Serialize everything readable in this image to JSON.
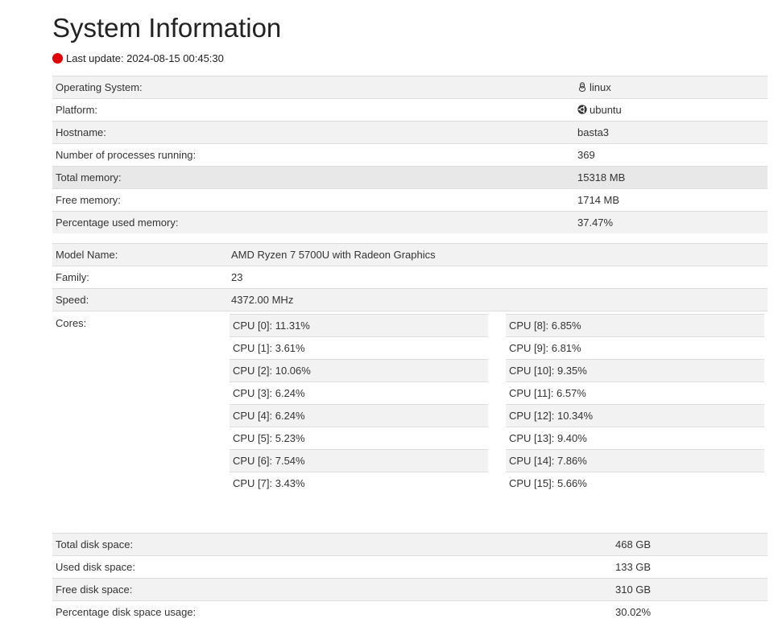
{
  "header": {
    "title": "System Information",
    "last_update_label": "Last update: 2024-08-15 00:45:30",
    "status_color": "#e00000"
  },
  "system": [
    {
      "label": "Operating System:",
      "value": "linux",
      "icon": "linux-tux-icon"
    },
    {
      "label": "Platform:",
      "value": "ubuntu",
      "icon": "ubuntu-icon"
    },
    {
      "label": "Hostname:",
      "value": "basta3"
    },
    {
      "label": "Number of processes running:",
      "value": "369"
    },
    {
      "label": "Total memory:",
      "value": "15318 MB"
    },
    {
      "label": "Free memory:",
      "value": "1714 MB"
    },
    {
      "label": "Percentage used memory:",
      "value": "37.47%"
    }
  ],
  "cpu": {
    "model_label": "Model Name:",
    "model_value": "AMD Ryzen 7 5700U with Radeon Graphics",
    "family_label": "Family:",
    "family_value": "23",
    "speed_label": "Speed:",
    "speed_value": "4372.00 MHz",
    "cores_label": "Cores:",
    "cores_left": [
      "CPU [0]: 11.31%",
      "CPU [1]: 3.61%",
      "CPU [2]: 10.06%",
      "CPU [3]: 6.24%",
      "CPU [4]: 6.24%",
      "CPU [5]: 5.23%",
      "CPU [6]: 7.54%",
      "CPU [7]: 3.43%"
    ],
    "cores_right": [
      "CPU [8]: 6.85%",
      "CPU [9]: 6.81%",
      "CPU [10]: 9.35%",
      "CPU [11]: 6.57%",
      "CPU [12]: 10.34%",
      "CPU [13]: 9.40%",
      "CPU [14]: 7.86%",
      "CPU [15]: 5.66%"
    ]
  },
  "disk": [
    {
      "label": "Total disk space:",
      "value": "468 GB"
    },
    {
      "label": "Used disk space:",
      "value": "133 GB"
    },
    {
      "label": "Free disk space:",
      "value": "310 GB"
    },
    {
      "label": "Percentage disk space usage:",
      "value": "30.02%"
    }
  ]
}
